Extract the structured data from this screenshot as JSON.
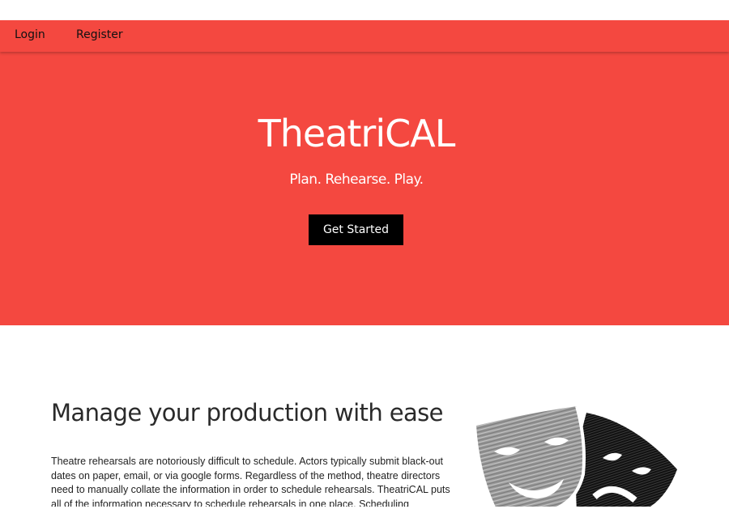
{
  "nav": {
    "login": "Login",
    "register": "Register"
  },
  "hero": {
    "title": "TheatriCAL",
    "tagline": "Plan. Rehearse. Play.",
    "cta": "Get Started"
  },
  "content": {
    "heading": "Manage your production with ease",
    "body": "Theatre rehearsals are notoriously difficult to schedule. Actors typically submit black-out dates on paper, email, or via google forms. Regardless of the method, theatre directors need to manually collate the information in order to schedule rehearsals. TheatriCAL puts all of the information necessary to schedule rehearsals in one place. Scheduling"
  },
  "colors": {
    "brand": "#f44840",
    "button": "#000000"
  },
  "icons": {
    "hero_image": "theatre-masks-icon"
  }
}
